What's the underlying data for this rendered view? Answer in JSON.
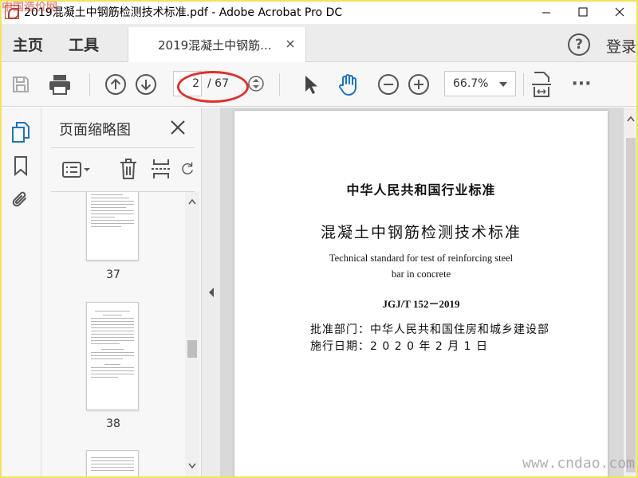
{
  "window": {
    "title": "2019混凝土中钢筋检测技术标准.pdf - Adobe Acrobat Pro DC"
  },
  "watermark": {
    "top_left": "中国造价网",
    "bottom_right": "www.cndao.com"
  },
  "menu": {
    "home_label": "主页",
    "tools_label": "工具",
    "doc_tab_label": "2019混凝土中钢筋...",
    "help_symbol": "?",
    "login_label": "登录"
  },
  "toolbar": {
    "page_current": "2",
    "page_total": "/ 67",
    "zoom_value": "66.7%",
    "more_label": "···"
  },
  "thumbnails": {
    "panel_title": "页面缩略图",
    "pages": [
      {
        "number": "37"
      },
      {
        "number": "38"
      }
    ]
  },
  "document": {
    "heading1": "中华人民共和国行业标准",
    "heading2": "混凝土中钢筋检测技术标准",
    "english_line1": "Technical standard for test of reinforcing steel",
    "english_line2": "bar in concrete",
    "code": "JGJ/T 152－2019",
    "approver_label": "批准部门：",
    "approver_value": "中华人民共和国住房和城乡建设部",
    "effective_label": "施行日期：",
    "effective_value": "2 0 2 0 年 2 月 1 日"
  },
  "colors": {
    "annotation_red": "#e0302a",
    "accent_blue": "#1a73c8"
  },
  "icons": [
    "app-icon",
    "minimize-icon",
    "maximize-icon",
    "close-icon",
    "save-icon",
    "print-icon",
    "page-up-icon",
    "page-down-icon",
    "page-stepper-icon",
    "select-arrow-icon",
    "hand-tool-icon",
    "zoom-out-icon",
    "zoom-in-icon",
    "fit-page-icon",
    "more-icon",
    "thumbnails-icon",
    "bookmark-icon",
    "attachment-icon",
    "page-options-icon",
    "delete-icon",
    "insert-page-icon",
    "rotate-icon",
    "scroll-up-icon",
    "scroll-down-icon",
    "collapse-panel-icon"
  ]
}
